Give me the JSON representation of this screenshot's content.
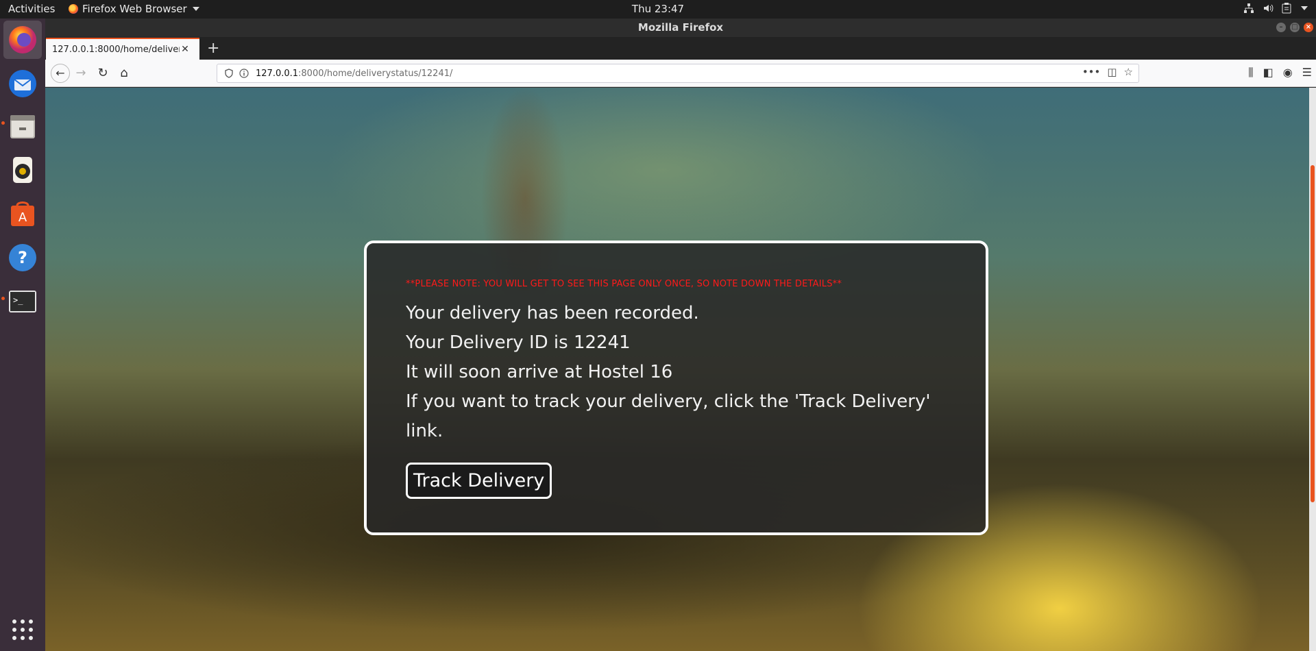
{
  "topbar": {
    "activities": "Activities",
    "app_name": "Firefox Web Browser",
    "clock": "Thu 23:47"
  },
  "dock": {
    "items": [
      "Firefox",
      "Thunderbird",
      "Files",
      "Rhythmbox",
      "Ubuntu Software",
      "Help",
      "Terminal"
    ]
  },
  "window": {
    "title": "Mozilla Firefox",
    "tab_title": "127.0.0.1:8000/home/deliveryst",
    "url_host": "127.0.0.1",
    "url_path": ":8000/home/deliverystatus/12241/"
  },
  "page": {
    "notice": "**PLEASE NOTE: YOU WILL GET TO SEE THIS PAGE ONLY ONCE, SO NOTE DOWN THE DETAILS**",
    "line1": "Your delivery has been recorded.",
    "line2": "Your Delivery ID is 12241",
    "line3": "It will soon arrive at Hostel 16",
    "line4": "If you want to track your delivery, click the 'Track Delivery' link.",
    "button_label": "Track Delivery"
  },
  "colors": {
    "accent": "#e95420",
    "notice": "#ff1a1a"
  }
}
